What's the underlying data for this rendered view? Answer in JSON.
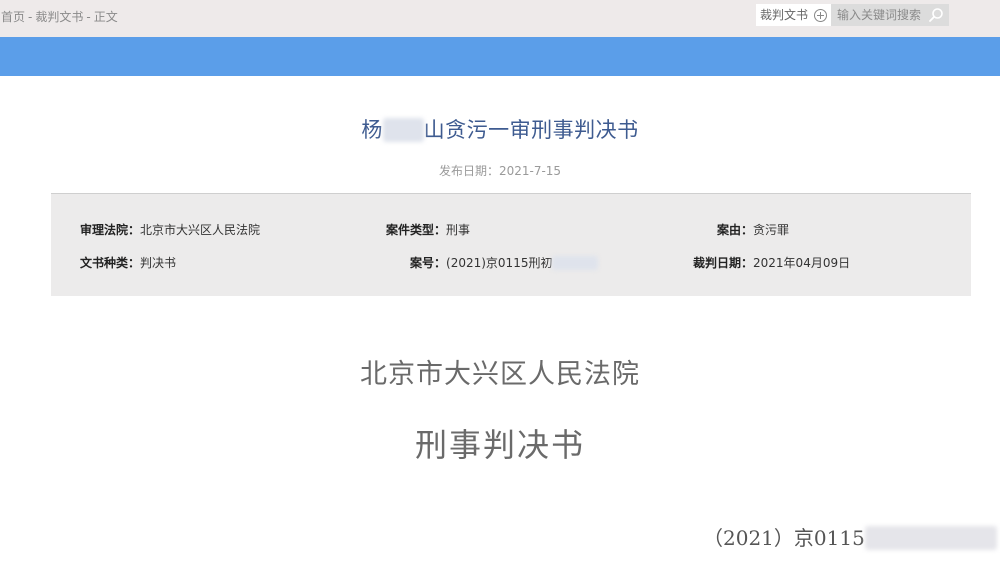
{
  "breadcrumb": {
    "items": [
      "首页",
      "裁判文书",
      "正文"
    ],
    "separator": "-"
  },
  "search": {
    "category": "裁判文书",
    "placeholder": "输入关键词搜索"
  },
  "document": {
    "title_prefix": "杨",
    "title_redacted": "■■",
    "title_suffix": "山贪污一审刑事判决书",
    "publish_label": "发布日期：",
    "publish_date": "2021-7-15"
  },
  "info": {
    "court_label": "审理法院：",
    "court_value": "北京市大兴区人民法院",
    "case_type_label": "案件类型：",
    "case_type_value": "刑事",
    "cause_label": "案由：",
    "cause_value": "贪污罪",
    "doc_kind_label": "文书种类：",
    "doc_kind_value": "判决书",
    "case_no_label": "案号：",
    "case_no_value": "(2021)京0115刑初",
    "case_no_redacted": "■■■■",
    "judge_date_label": "裁判日期：",
    "judge_date_value": "2021年04月09日"
  },
  "body": {
    "court_header": "北京市大兴区人民法院",
    "doc_type": "刑事判决书",
    "case_line": "（2021）京0115",
    "case_line_redacted": "■■■■■■■"
  },
  "colors": {
    "blue_bar": "#5b9ee9",
    "title": "#3e5b90",
    "topbar": "#eeeaea",
    "panel": "#ecebeb"
  }
}
